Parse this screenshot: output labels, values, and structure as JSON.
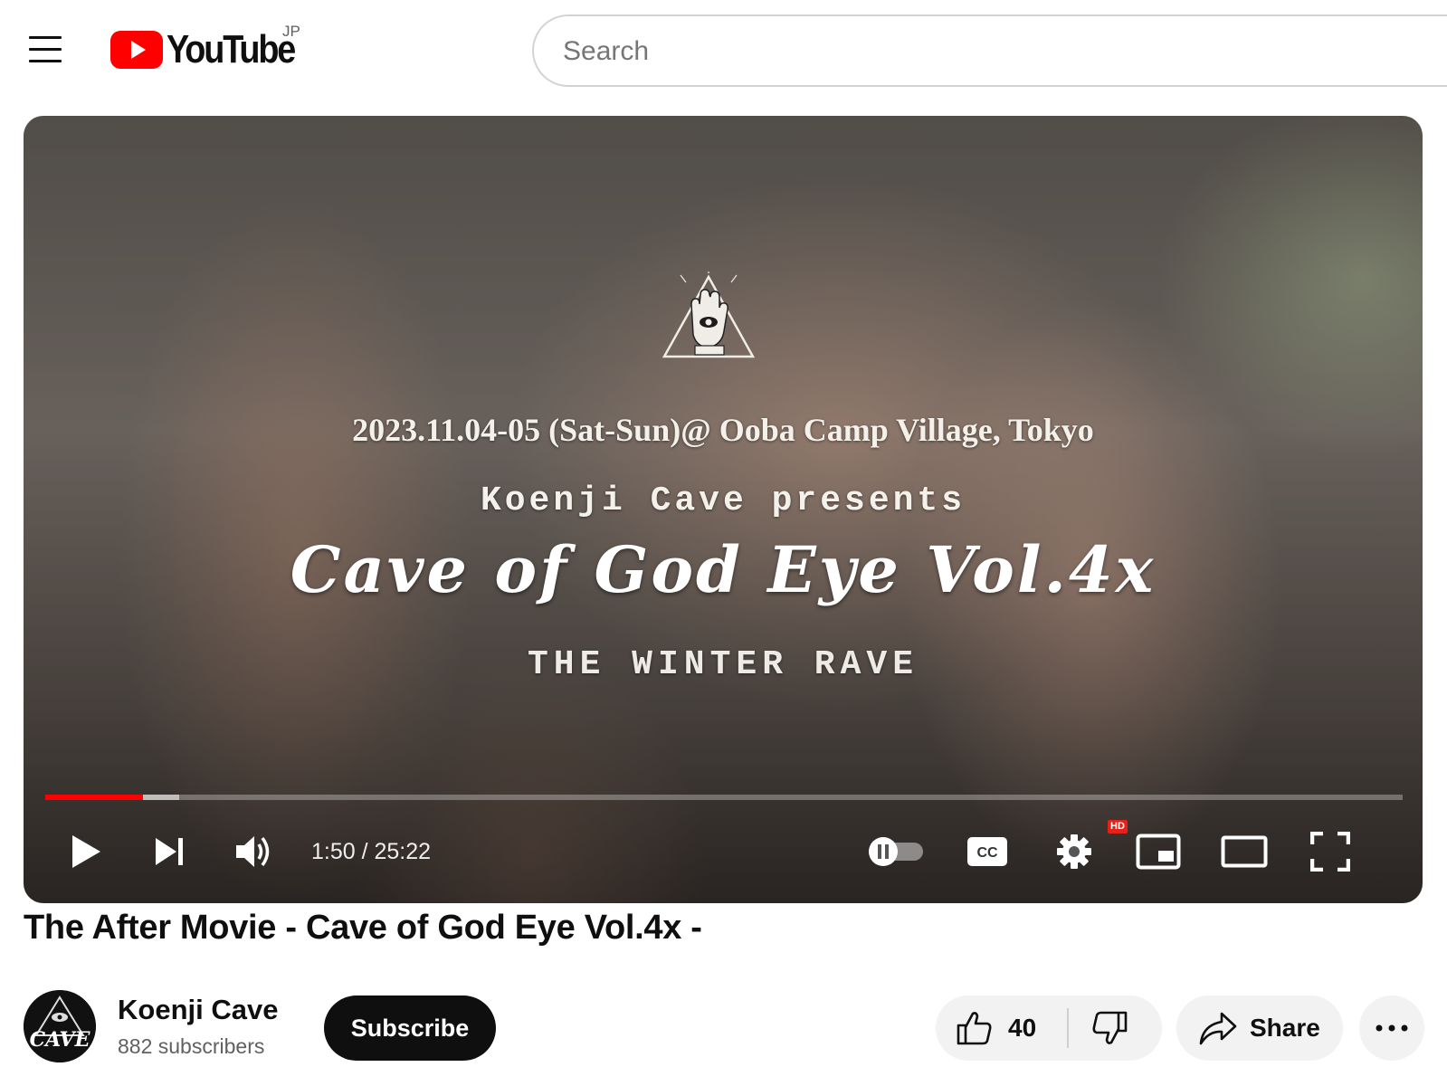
{
  "header": {
    "logo_text": "YouTube",
    "region_code": "JP",
    "search_placeholder": "Search"
  },
  "player": {
    "overlay": {
      "date_line": "2023.11.04-05 (Sat-Sun)@ Ooba Camp Village, Tokyo",
      "presents_line": "Koenji Cave presents",
      "event_title": "Cave of God Eye Vol.4x",
      "subtitle": "THE WINTER RAVE"
    },
    "time_display": "1:50 / 25:22",
    "progress_played_fraction": 0.0723,
    "progress_buffered_fraction": 0.099,
    "quality_badge": "HD",
    "cc_label": "CC",
    "accent_color": "#ff0000"
  },
  "video": {
    "title": "The After Movie - Cave of God Eye Vol.4x -"
  },
  "channel": {
    "name": "Koenji Cave",
    "subscribers": "882 subscribers",
    "avatar_text": "CAVE"
  },
  "actions": {
    "subscribe_label": "Subscribe",
    "like_count": "40",
    "share_label": "Share"
  }
}
